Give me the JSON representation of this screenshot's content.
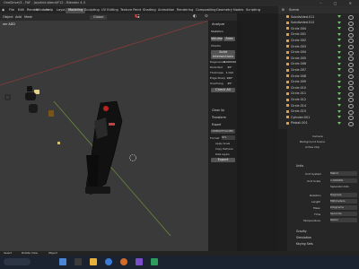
{
  "title_bar": {
    "text": "OneDrive\\3 - FAF - Joystick.blend\\F12 - Blender 4.3",
    "controls": "–  ▢  ✕"
  },
  "menu": {
    "items": [
      "File",
      "Edit",
      "Render",
      "Window",
      "Help"
    ],
    "workspaces": [
      "Layout",
      "Modeling",
      "Sculpting",
      "UV Editing",
      "Texture Paint",
      "Shading",
      "Animation",
      "Rendering",
      "Compositing",
      "Geometry Nodes",
      "Scripting"
    ],
    "active_workspace": "Modeling"
  },
  "toolbar": {
    "items": [
      "Object",
      "Add",
      "Mesh"
    ],
    "orientation": "Global",
    "viewport_label": "ser ADD"
  },
  "npanel": {
    "header": "3D-Print",
    "sections": {
      "analyze": "Analyze",
      "statistics": "Statistics",
      "volume": "Volume",
      "area": "Area",
      "checks": "Checks",
      "solid": "Solid",
      "intersections": "Intersections",
      "degenerate": "Degenerate",
      "degenerate_val": "0.000010",
      "distorted": "Distorted",
      "distorted_val": "45°",
      "thickness": "Thickness",
      "thickness_val": "1 mm",
      "edge_sharp": "Edge Sharp",
      "edge_sharp_val": "160°",
      "overhang": "Overhang",
      "overhang_val": "45°",
      "check_all": "Check All",
      "clean_up": "Clean Up",
      "transform": "Transform",
      "export": "Export",
      "export_path": "\\3DPRINTFOLDER\\",
      "format_label": "Format",
      "format_val": "STL",
      "apply_scale": "Apply Scale",
      "copy_textures": "Copy Textures",
      "data_layers": "Data Layers",
      "export_btn": "Export"
    }
  },
  "outliner": {
    "header": "Scene",
    "items": [
      "Subdivided.011",
      "Subdivided.012",
      "Circle.004",
      "Circle.001",
      "Circle.002",
      "Circle.003",
      "Circle.004",
      "Circle.005",
      "Circle.006",
      "Circle.007",
      "Circle.008",
      "Circle.009",
      "Circle.010",
      "Circle.011",
      "Circle.012",
      "Circle.014",
      "Circle.015",
      "Cylinder.001",
      "Pinball.001"
    ]
  },
  "properties": {
    "scene_label": "Scene",
    "camera": "Camera",
    "background_scene": "Background Scene",
    "active_clip": "Active Clip",
    "units_section": "Units",
    "unit_system": "Unit System",
    "unit_system_val": "Metric",
    "unit_scale": "Unit Scale",
    "unit_scale_val": "1.000000",
    "separate_units": "Separate Units",
    "rotation": "Rotation",
    "rotation_val": "Degrees",
    "length": "Length",
    "length_val": "Millimeters",
    "mass": "Mass",
    "mass_val": "Kilograms",
    "time": "Time",
    "time_val": "Seconds",
    "temperature": "Temperature",
    "temperature_val": "Kelvin",
    "gravity": "Gravity",
    "simulation": "Simulation",
    "keying_sets": "Keying Sets"
  },
  "statusbar": {
    "left": "Select",
    "mid": "Rotate View",
    "right": "Object"
  },
  "colors": {
    "accent": "#4772b3",
    "outliner_obj": "#e0a050",
    "tri": "#6ec26a"
  }
}
